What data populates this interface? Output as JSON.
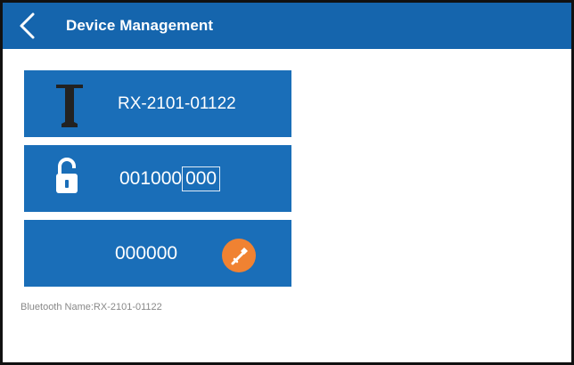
{
  "header": {
    "title": "Device Management",
    "back_icon": "chevron-left-icon",
    "color": "#1565ad"
  },
  "cards": {
    "device": {
      "label": "RX-2101-01122",
      "icon": "tool-icon"
    },
    "unlock": {
      "code_prefix": "001000",
      "code_boxed": "000",
      "icon": "unlock-icon"
    },
    "password": {
      "label": "000000",
      "icon": "key-icon",
      "icon_color": "#f08232"
    },
    "color": "#1a6eb8"
  },
  "footer": {
    "bluetooth_label": "Bluetooth Name:RX-2101-01122"
  }
}
